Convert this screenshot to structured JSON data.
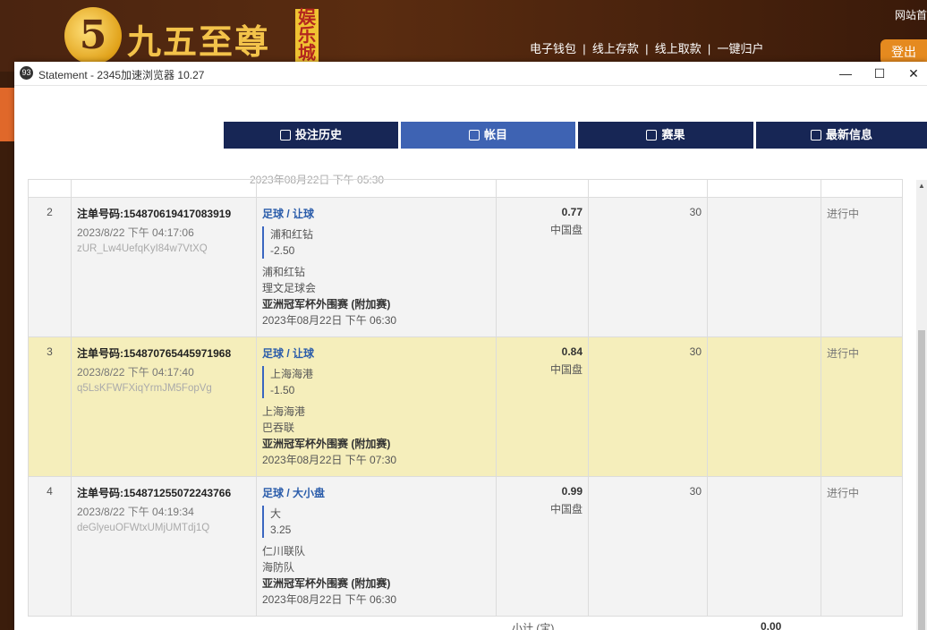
{
  "site": {
    "logo_char": "5",
    "logo_text": "九五至尊",
    "logo_badge": "娱乐城",
    "nav": [
      "电子钱包",
      "线上存款",
      "线上取款",
      "一键归户"
    ],
    "top_right": "网站首",
    "login": "登出"
  },
  "window": {
    "app_icon": "93",
    "title": "Statement - 2345加速浏览器 10.27",
    "controls": [
      "—",
      "☐",
      "✕"
    ]
  },
  "tabs": [
    {
      "label": "投注历史",
      "icon": "history-icon"
    },
    {
      "label": "帐目",
      "icon": "ledger-icon",
      "active": true
    },
    {
      "label": "赛果",
      "icon": "results-icon"
    },
    {
      "label": "最新信息",
      "icon": "mail-icon"
    }
  ],
  "partial_row_text": "2023年08月22日 下午 05:30",
  "bets": [
    {
      "num": "2",
      "bet_id": "注单号码:154870619417083919",
      "time": "2023/8/22 下午 04:17:06",
      "hash": "zUR_Lw4UefqKyI84w7VtXQ",
      "sport": "足球 / 让球",
      "pick": "浦和红钻",
      "handicap": "-2.50",
      "home": "浦和红钻",
      "away": "理文足球会",
      "league": "亚洲冠军杯外围赛 (附加赛)",
      "kickoff": "2023年08月22日 下午 06:30",
      "odds": "0.77",
      "odds_type": "中国盘",
      "stake": "30",
      "status": "进行中",
      "highlight": false
    },
    {
      "num": "3",
      "bet_id": "注单号码:154870765445971968",
      "time": "2023/8/22 下午 04:17:40",
      "hash": "q5LsKFWFXiqYrmJM5FopVg",
      "sport": "足球 / 让球",
      "pick": "上海海港",
      "handicap": "-1.50",
      "home": "上海海港",
      "away": "巴吞联",
      "league": "亚洲冠军杯外围赛 (附加赛)",
      "kickoff": "2023年08月22日 下午 07:30",
      "odds": "0.84",
      "odds_type": "中国盘",
      "stake": "30",
      "status": "进行中",
      "highlight": true
    },
    {
      "num": "4",
      "bet_id": "注单号码:154871255072243766",
      "time": "2023/8/22 下午 04:19:34",
      "hash": "deGlyeuOFWtxUMjUMTdj1Q",
      "sport": "足球 / 大小盘",
      "pick": "大",
      "handicap": "3.25",
      "home": "仁川联队",
      "away": "海防队",
      "league": "亚洲冠军杯外围赛 (附加赛)",
      "kickoff": "2023年08月22日 下午 06:30",
      "odds": "0.99",
      "odds_type": "中国盘",
      "stake": "30",
      "status": "进行中",
      "highlight": false
    }
  ],
  "footer": {
    "subtotal_label": "小计 (宝)",
    "subtotal_value": "0.00"
  }
}
